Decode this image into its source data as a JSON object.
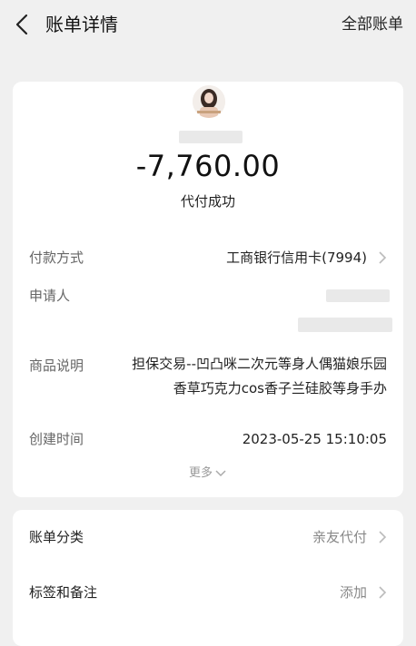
{
  "header": {
    "title": "账单详情",
    "all_bills_label": "全部账单"
  },
  "summary": {
    "amount": "-7,760.00",
    "status": "代付成功"
  },
  "details": {
    "payment_method_label": "付款方式",
    "payment_method_value": "工商银行信用卡(7994)",
    "applicant_label": "申请人",
    "product_label": "商品说明",
    "product_line1": "担保交易--凹凸咪二次元等身人偶猫娘乐园",
    "product_line2": "香草巧克力cos香子兰硅胶等身手办",
    "created_label": "创建时间",
    "created_value": "2023-05-25 15:10:05",
    "more_label": "更多"
  },
  "settings": {
    "category_label": "账单分类",
    "category_value": "亲友代付",
    "tags_label": "标签和备注",
    "tags_value": "添加"
  },
  "icons": {
    "back": "chevron-left-icon",
    "row_arrow": "chevron-right-icon",
    "more": "chevron-down-icon"
  },
  "colors": {
    "background": "#f0f0f0",
    "card": "#ffffff",
    "muted_text": "#888888"
  }
}
